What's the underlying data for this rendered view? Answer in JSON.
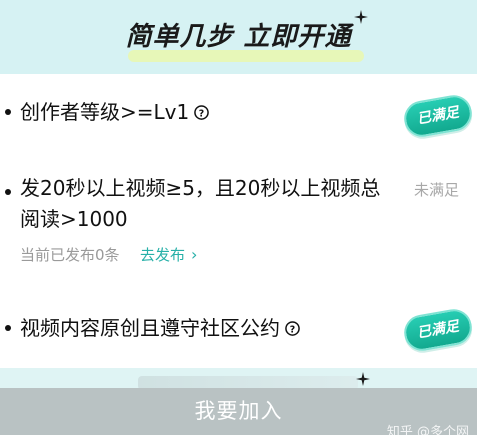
{
  "header": {
    "title": "简单几步 立即开通",
    "sparkle_icon": "sparkle-icon"
  },
  "requirements": [
    {
      "text": "创作者等级>=Lv1",
      "has_help_icon": true,
      "status_label": "已满足",
      "status": "met"
    },
    {
      "text_line1": "发20秒以上视频≥5，且20秒以上视频总",
      "text_line2": "阅读>1000",
      "status_label": "未满足",
      "status": "unmet",
      "note": "当前已发布0条",
      "link_label": "去发布",
      "link_chevron": "›"
    },
    {
      "text": "视频内容原创且遵守社区公约",
      "has_help_icon": true,
      "status_label": "已满足",
      "status": "met"
    }
  ],
  "footer": {
    "join_label": "我要加入",
    "watermark": "知乎 @多个网"
  },
  "colors": {
    "header_bg": "#d6f2f3",
    "badge_met": "#12a98f",
    "link": "#27b0a8",
    "unmet_text": "#a8a8a8",
    "join_bar": "#b9c2c3"
  }
}
